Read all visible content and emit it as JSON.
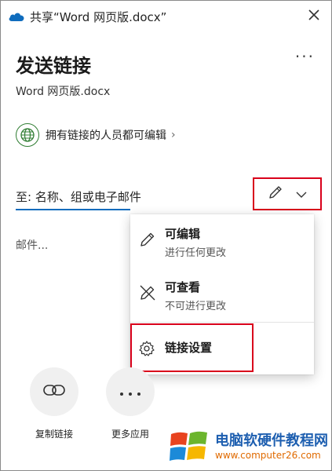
{
  "window": {
    "title": "共享“Word 网页版.docx”"
  },
  "header": {
    "title": "发送链接",
    "filename": "Word 网页版.docx",
    "more_label": "···"
  },
  "permission": {
    "text": "拥有链接的人员都可编辑",
    "chevron": "›"
  },
  "recipients": {
    "placeholder": "至: 名称、组或电子邮件"
  },
  "message": {
    "placeholder": "邮件..."
  },
  "menu": {
    "items": [
      {
        "title": "可编辑",
        "subtitle": "进行任何更改"
      },
      {
        "title": "可查看",
        "subtitle": "不可进行更改"
      },
      {
        "title": "链接设置"
      }
    ]
  },
  "actions": [
    {
      "label": "复制链接"
    },
    {
      "label": "更多应用"
    }
  ],
  "watermark": {
    "name": "电脑软硬件教程网",
    "url": "www.computer26.com"
  },
  "colors": {
    "accent": "#0f6cbd",
    "highlight": "#d9001b",
    "globe": "#2f7d32"
  }
}
